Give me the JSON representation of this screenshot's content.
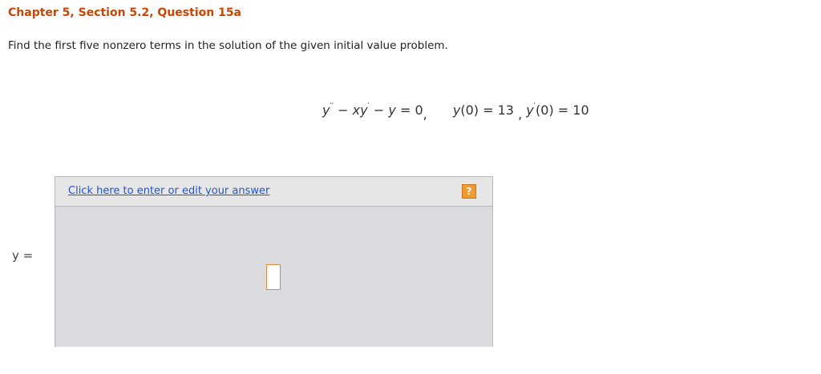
{
  "question": {
    "title": "Chapter 5, Section 5.2, Question 15a",
    "text": "Find the first five nonzero terms in the solution of the given initial value problem."
  },
  "equation": {
    "y1": "y",
    "sup1": "′′",
    "op1": " − ",
    "x": "x",
    "y2": "y",
    "sup2": "′",
    "op2": " − ",
    "y3": "y",
    "eq1": " = 0",
    "comma1": ",",
    "y4": "y",
    "ic1": "(0) = 13",
    "comma2": ",",
    "y5": "y",
    "sup3": "′",
    "ic2": "(0) = 10"
  },
  "answer": {
    "y_label": "y =",
    "link_text": "Click here to enter or edit your answer",
    "help_symbol": "?"
  },
  "colors": {
    "title": "#cc4400",
    "link": "#2255cc",
    "help": "#f29a2e",
    "panel": "#d9dbdf"
  }
}
